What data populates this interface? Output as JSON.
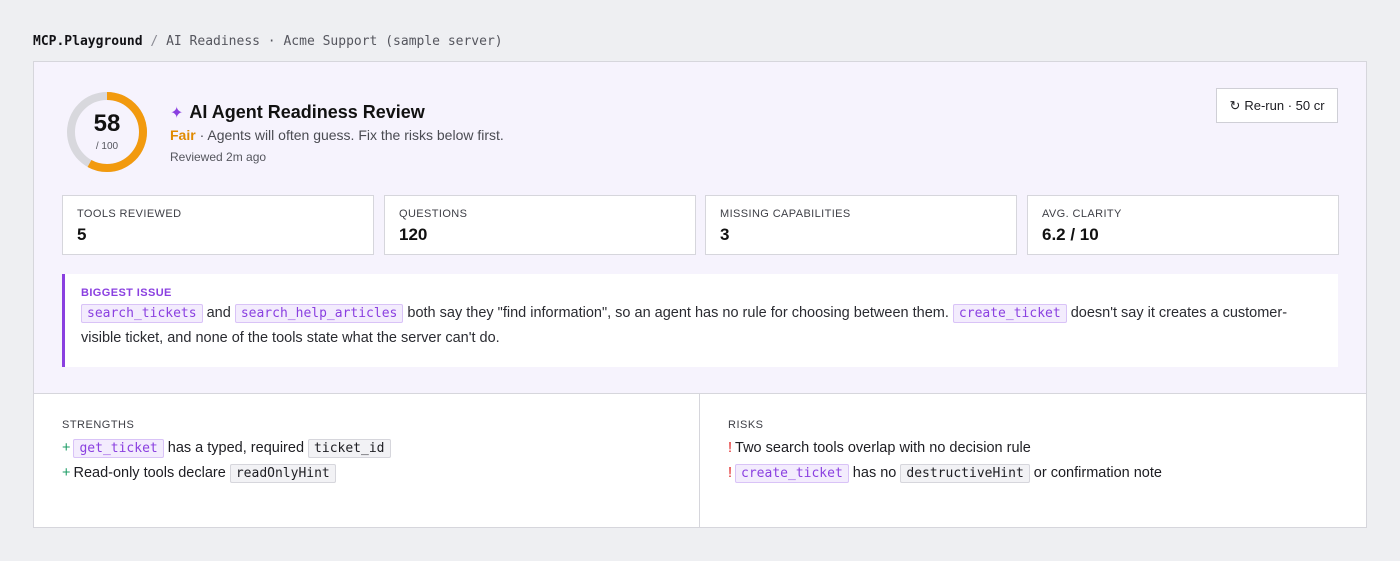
{
  "breadcrumb": {
    "brand": "MCP.Playground",
    "separator": "/",
    "path": "AI Readiness · Acme Support (sample server)"
  },
  "review": {
    "score": "58",
    "score_max": "/ 100",
    "score_fraction": 0.58,
    "title": "AI Agent Readiness Review",
    "sparkle": "✦",
    "rating": "Fair",
    "rating_desc": " · Agents will often guess. Fix the risks below first.",
    "reviewed": "Reviewed 2m ago",
    "rerun_icon": "↻",
    "rerun_label": "Re-run · 50 cr"
  },
  "stats": [
    {
      "label": "TOOLS REVIEWED",
      "value": "5"
    },
    {
      "label": "QUESTIONS",
      "value": "120"
    },
    {
      "label": "MISSING CAPABILITIES",
      "value": "3"
    },
    {
      "label": "AVG. CLARITY",
      "value": "6.2 / 10"
    }
  ],
  "issue": {
    "label": "BIGGEST ISSUE",
    "tool1": "search_tickets",
    "and": " and ",
    "tool2": "search_help_articles",
    "text1": " both say they \"find information\", so an agent has no rule for choosing between them. ",
    "tool3": "create_ticket",
    "text2": " doesn't say it creates a customer-visible ticket, and none of the tools state what the server can't do."
  },
  "strengths": {
    "title": "STRENGTHS",
    "marker": "+",
    "items": [
      {
        "code1": "get_ticket",
        "text1": " has a typed, required ",
        "code2": "ticket_id"
      },
      {
        "text1": "Read-only tools declare ",
        "code2": "readOnlyHint"
      }
    ]
  },
  "risks": {
    "title": "RISKS",
    "marker": "!",
    "items": [
      {
        "text1": "Two search tools overlap with no decision rule"
      },
      {
        "code1": "create_ticket",
        "text1": " has no ",
        "code2": "destructiveHint",
        "text2": " or confirmation note"
      }
    ]
  },
  "colors": {
    "accent": "#8a3fe0",
    "rating": "#e08a00",
    "strength": "#1a9b63",
    "risk": "#e02424"
  }
}
